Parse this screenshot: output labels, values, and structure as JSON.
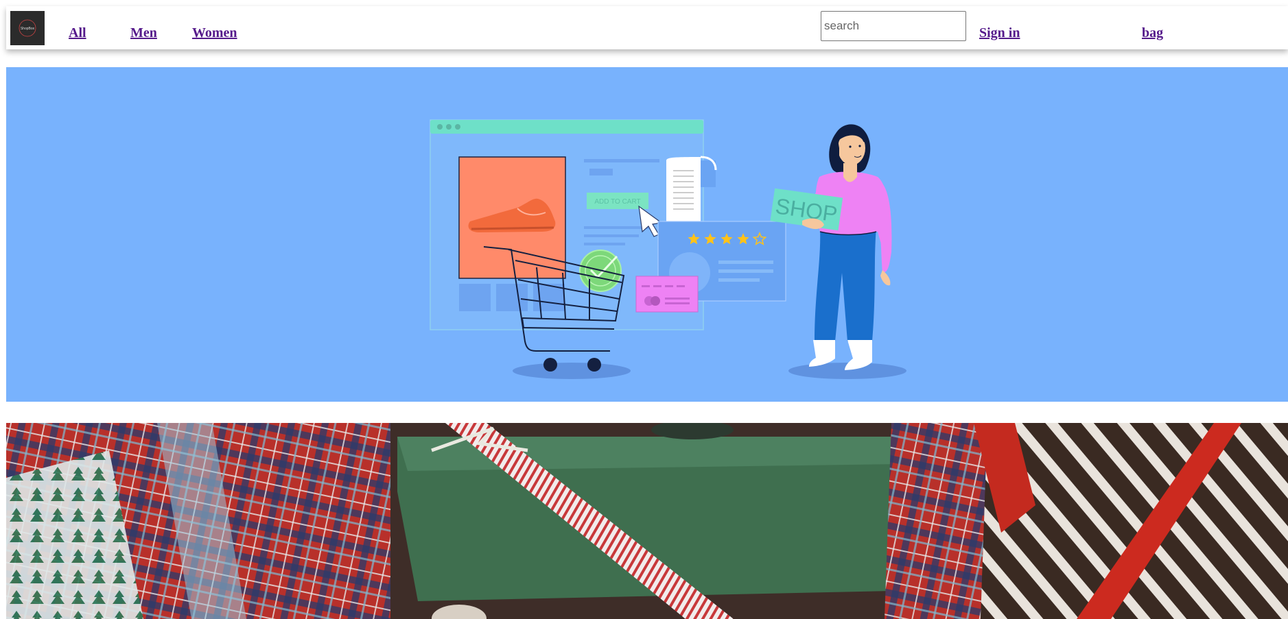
{
  "logo": {
    "text": "ShopBox",
    "icon": "shop-logo"
  },
  "nav": {
    "all": "All",
    "men": "Men",
    "women": "Women",
    "sign_in": "Sign in",
    "bag": "bag"
  },
  "search": {
    "placeholder": "search",
    "value": ""
  },
  "hero": {
    "button_text": "ADD TO CART",
    "sign_text": "SHOP",
    "rating_stars": 4,
    "rating_max": 5,
    "colors": {
      "background": "#78b2fd",
      "browser_bar": "#6ee0c8",
      "product_card": "#ff8a6a",
      "shoe": "#f26a3c",
      "top": "#ee82f4",
      "pants": "#1a6fcc",
      "check": "#7dd87a",
      "card": "#ee82f4",
      "star": "#ffc21a"
    }
  },
  "banner_photo": {
    "subject": "wrapped gift boxes",
    "icon": "gift-photo"
  }
}
